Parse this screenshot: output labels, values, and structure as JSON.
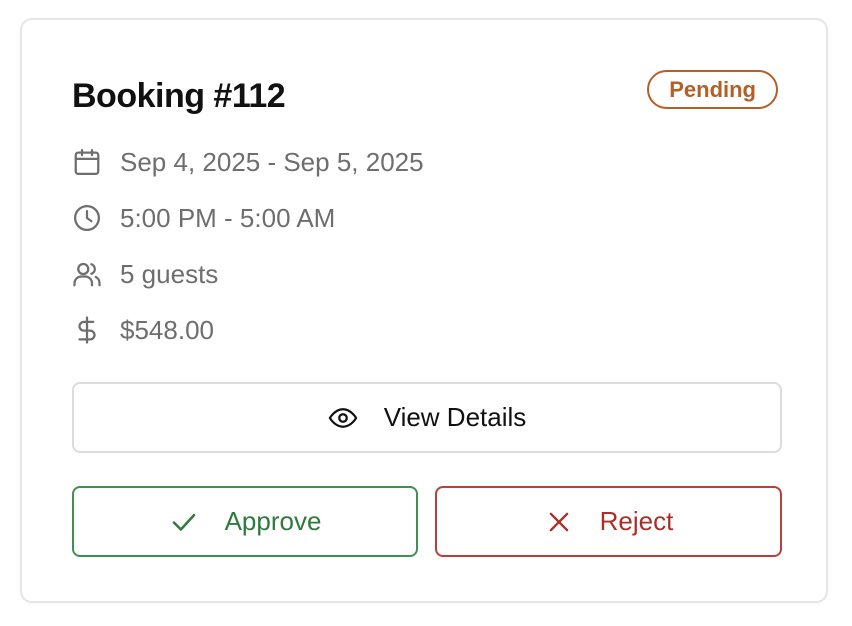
{
  "booking": {
    "title": "Booking #112",
    "status": "Pending",
    "status_color": "#b45f28"
  },
  "details": {
    "dates": {
      "icon": "calendar-icon",
      "text": "Sep 4, 2025 - Sep 5, 2025"
    },
    "time": {
      "icon": "clock-icon",
      "text": "5:00 PM - 5:00 AM"
    },
    "guests": {
      "icon": "users-icon",
      "text": "5 guests"
    },
    "price": {
      "icon": "dollar-icon",
      "text": "$548.00"
    }
  },
  "actions": {
    "view_details": {
      "icon": "eye-icon",
      "label": "View Details"
    },
    "approve": {
      "icon": "check-icon",
      "label": "Approve",
      "color": "#2f7a3d"
    },
    "reject": {
      "icon": "x-icon",
      "label": "Reject",
      "color": "#a83029"
    }
  }
}
